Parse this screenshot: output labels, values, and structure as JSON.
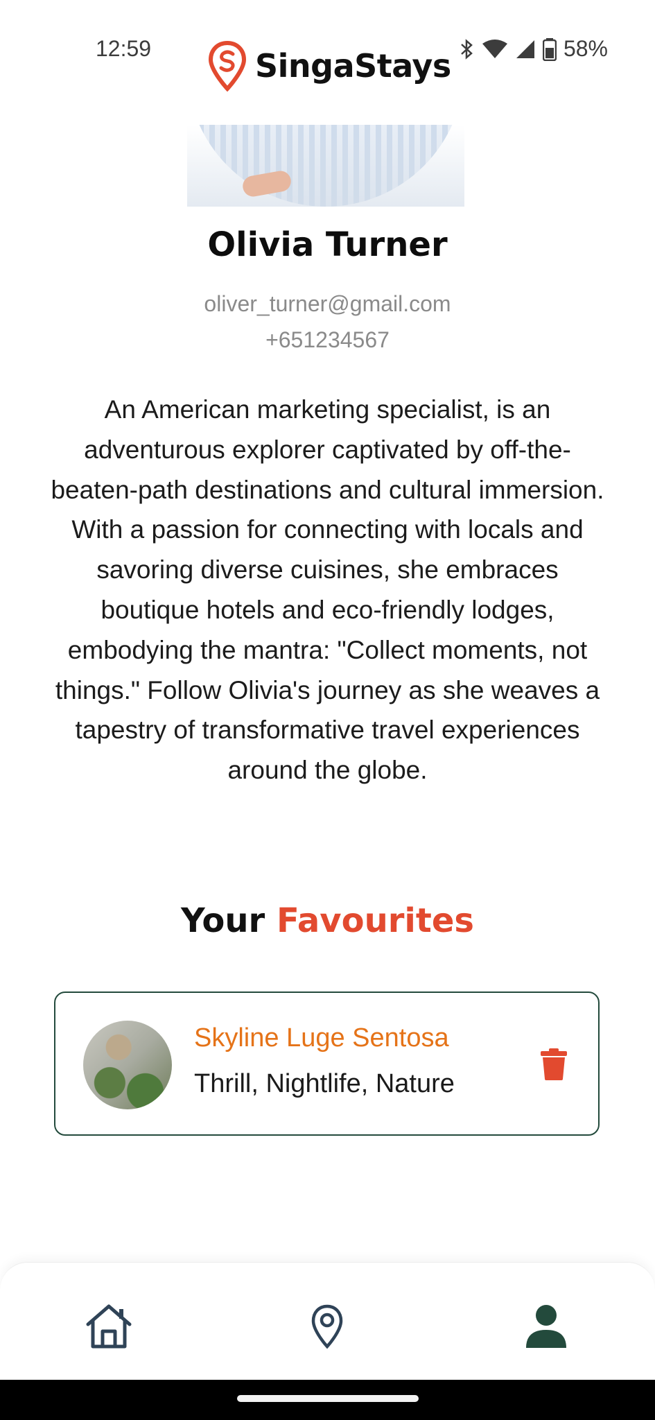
{
  "status_bar": {
    "time": "12:59",
    "battery": "58%"
  },
  "app": {
    "name": "SingaStays",
    "brand_color": "#e24a2f",
    "accent_green": "#234a3c"
  },
  "profile": {
    "name": "Olivia Turner",
    "email": "oliver_turner@gmail.com",
    "phone": "+651234567",
    "bio": "An American marketing specialist, is an adventurous explorer captivated by off-the-beaten-path destinations and cultural immersion. With a passion for connecting with locals and savoring diverse cuisines, she embraces boutique hotels and eco-friendly lodges, embodying the mantra: \"Collect moments, not things.\" Follow Olivia's journey as she weaves a tapestry of transformative travel experiences around the globe."
  },
  "favourites": {
    "heading_part1": "Your",
    "heading_part2": "Favourites",
    "items": [
      {
        "title": "Skyline Luge Sentosa",
        "tags": "Thrill, Nightlife, Nature",
        "delete_icon": "trash-icon"
      }
    ]
  },
  "nav": {
    "items": [
      {
        "icon": "home-icon",
        "active": false
      },
      {
        "icon": "map-pin-icon",
        "active": false
      },
      {
        "icon": "user-icon",
        "active": true
      }
    ]
  }
}
